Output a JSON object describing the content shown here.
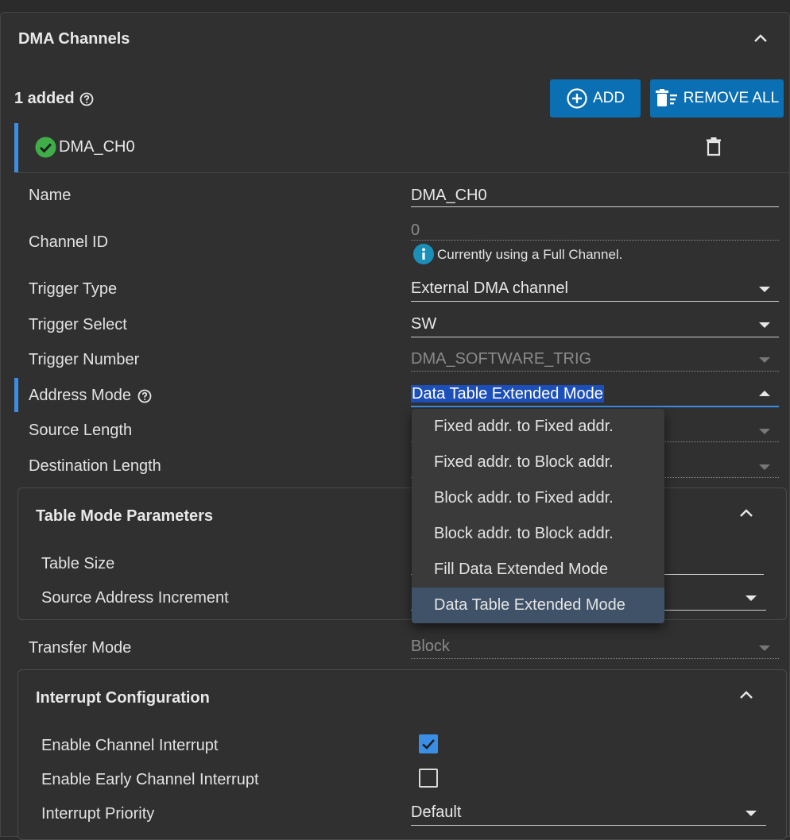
{
  "section": {
    "title": "DMA Channels",
    "added_label": "1 added"
  },
  "buttons": {
    "add": "ADD",
    "remove_all": "REMOVE ALL"
  },
  "channel": {
    "name": "DMA_CH0"
  },
  "fields": {
    "name": {
      "label": "Name",
      "value": "DMA_CH0"
    },
    "channel_id": {
      "label": "Channel ID",
      "value": "0",
      "info": "Currently using a Full Channel."
    },
    "trigger_type": {
      "label": "Trigger Type",
      "value": "External DMA channel"
    },
    "trigger_select": {
      "label": "Trigger Select",
      "value": "SW"
    },
    "trigger_number": {
      "label": "Trigger Number",
      "value": "DMA_SOFTWARE_TRIG"
    },
    "address_mode": {
      "label": "Address Mode",
      "value": "Data Table Extended Mode"
    },
    "source_length": {
      "label": "Source Length"
    },
    "destination_length": {
      "label": "Destination Length"
    },
    "transfer_mode": {
      "label": "Transfer Mode",
      "value": "Block"
    }
  },
  "address_mode_options": [
    "Fixed addr. to Fixed addr.",
    "Fixed addr. to Block addr.",
    "Block addr. to Fixed addr.",
    "Block addr. to Block addr.",
    "Fill Data Extended Mode",
    "Data Table Extended Mode"
  ],
  "table_mode": {
    "title": "Table Mode Parameters",
    "table_size_label": "Table Size",
    "source_increment_label": "Source Address Increment"
  },
  "interrupt": {
    "title": "Interrupt Configuration",
    "enable_channel_label": "Enable Channel Interrupt",
    "enable_channel_checked": true,
    "enable_early_label": "Enable Early Channel Interrupt",
    "enable_early_checked": false,
    "priority_label": "Interrupt Priority",
    "priority_value": "Default"
  },
  "colors": {
    "accent": "#0a6fb3",
    "highlight_bar": "#3a8ee6",
    "success": "#3fae49",
    "info": "#1a8fb8"
  }
}
